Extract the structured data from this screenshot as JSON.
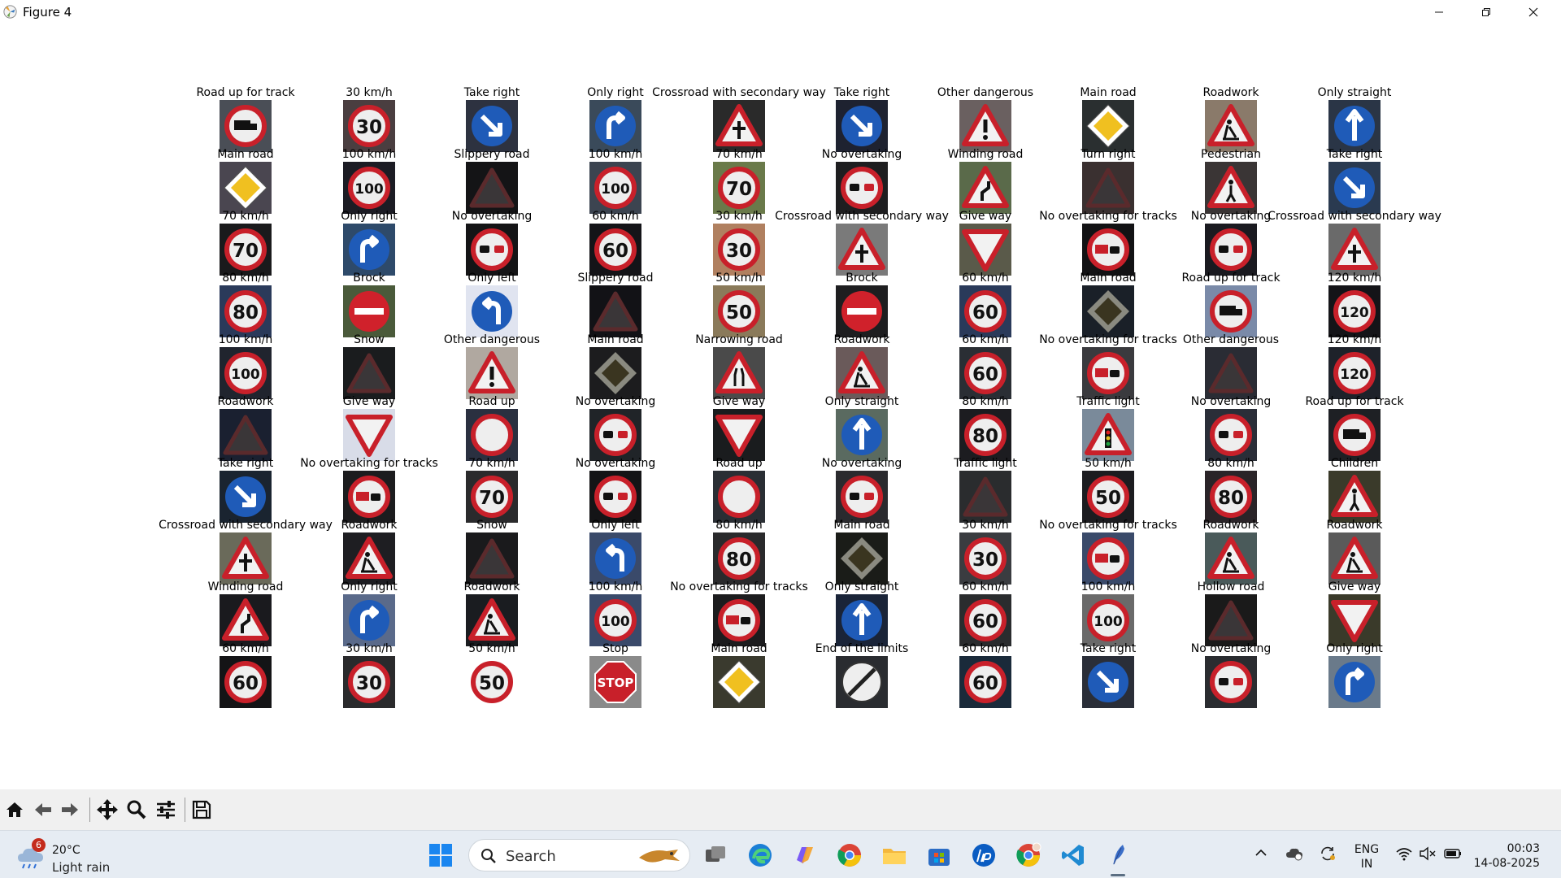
{
  "window": {
    "title": "Figure 4"
  },
  "grid": {
    "rows": [
      [
        {
          "label": "Road up for track",
          "kind": "truck",
          "bg": "#4a4e56"
        },
        {
          "label": "30 km/h",
          "kind": "speed",
          "num": "30",
          "bg": "#4a3e40"
        },
        {
          "label": "Take right",
          "kind": "blue_arrow_dr",
          "bg": "#2d3240"
        },
        {
          "label": "Only right",
          "kind": "blue_arrow_r",
          "bg": "#3a4a5a"
        },
        {
          "label": "Crossroad with secondary way",
          "kind": "tri_cross",
          "bg": "#2a2a2a"
        },
        {
          "label": "Take right",
          "kind": "blue_arrow_dr",
          "bg": "#1e2230"
        },
        {
          "label": "Other dangerous",
          "kind": "tri_excl",
          "bg": "#6a6060"
        },
        {
          "label": "Main road",
          "kind": "diamond",
          "bg": "#2a2f30"
        },
        {
          "label": "Roadwork",
          "kind": "tri_work",
          "bg": "#8a7a6a"
        },
        {
          "label": "Only straight",
          "kind": "blue_arrow_up",
          "bg": "#2a3546"
        }
      ],
      [
        {
          "label": "Main road",
          "kind": "diamond",
          "bg": "#4a4650"
        },
        {
          "label": "100 km/h",
          "kind": "speed",
          "num": "100",
          "bg": "#1c1c24"
        },
        {
          "label": "Slippery road",
          "kind": "tri_dark",
          "bg": "#141416"
        },
        {
          "label": "100 km/h",
          "kind": "speed",
          "num": "100",
          "bg": "#3c4450"
        },
        {
          "label": "70 km/h",
          "kind": "speed",
          "num": "70",
          "bg": "#6a7a4a"
        },
        {
          "label": "No overtaking",
          "kind": "nopass",
          "bg": "#1e1e20"
        },
        {
          "label": "Winding road",
          "kind": "tri_winding",
          "bg": "#5a6a4a"
        },
        {
          "label": "Turn right",
          "kind": "tri_dark",
          "bg": "#3a3030"
        },
        {
          "label": "Pedestrian",
          "kind": "tri_ped",
          "bg": "#3a3535"
        },
        {
          "label": "Take right",
          "kind": "blue_arrow_dr",
          "bg": "#2a3a50"
        }
      ],
      [
        {
          "label": "70 km/h",
          "kind": "speed",
          "num": "70",
          "bg": "#1a1a1c"
        },
        {
          "label": "Only right",
          "kind": "blue_arrow_r",
          "bg": "#2e4a6a"
        },
        {
          "label": "No overtaking",
          "kind": "nopass",
          "bg": "#141416"
        },
        {
          "label": "60 km/h",
          "kind": "speed",
          "num": "60",
          "bg": "#141418"
        },
        {
          "label": "30 km/h",
          "kind": "speed",
          "num": "30",
          "bg": "#b08060"
        },
        {
          "label": "Crossroad with secondary way",
          "kind": "tri_cross",
          "bg": "#7a7a7a"
        },
        {
          "label": "Give way",
          "kind": "giveway",
          "bg": "#5a5a4a"
        },
        {
          "label": "No overtaking for tracks",
          "kind": "notruck",
          "bg": "#121214"
        },
        {
          "label": "No overtaking",
          "kind": "nopass",
          "bg": "#1a1a20"
        },
        {
          "label": "Crossroad with secondary way",
          "kind": "tri_cross",
          "bg": "#6a6a6a"
        }
      ],
      [
        {
          "label": "80 km/h",
          "kind": "speed",
          "num": "80",
          "bg": "#2a3a5a"
        },
        {
          "label": "Brock",
          "kind": "noentry",
          "bg": "#4a5a3a"
        },
        {
          "label": "Only left",
          "kind": "blue_arrow_l",
          "bg": "#e0e4f0"
        },
        {
          "label": "Slippery road",
          "kind": "tri_dark",
          "bg": "#121216"
        },
        {
          "label": "50 km/h",
          "kind": "speed",
          "num": "50",
          "bg": "#8a7a5a"
        },
        {
          "label": "Brock",
          "kind": "noentry",
          "bg": "#1e1e20"
        },
        {
          "label": "60 km/h",
          "kind": "speed",
          "num": "60",
          "bg": "#2a3a5a"
        },
        {
          "label": "Main road",
          "kind": "diamond_dark",
          "bg": "#1a2028"
        },
        {
          "label": "Road up for track",
          "kind": "truck",
          "bg": "#7a8aa8"
        },
        {
          "label": "120 km/h",
          "kind": "speed",
          "num": "120",
          "bg": "#141418"
        }
      ],
      [
        {
          "label": "100 km/h",
          "kind": "speed",
          "num": "100",
          "bg": "#20242e"
        },
        {
          "label": "Snow",
          "kind": "tri_dark",
          "bg": "#1a1c1e"
        },
        {
          "label": "Other dangerous",
          "kind": "tri_excl",
          "bg": "#b0a8a0"
        },
        {
          "label": "Main road",
          "kind": "diamond_dark",
          "bg": "#1c1c1e"
        },
        {
          "label": "Narrowing road",
          "kind": "tri_narrow",
          "bg": "#4a4a4a"
        },
        {
          "label": "Roadwork",
          "kind": "tri_work",
          "bg": "#6a5a5a"
        },
        {
          "label": "60 km/h",
          "kind": "speed",
          "num": "60",
          "bg": "#2a2e34"
        },
        {
          "label": "No overtaking for tracks",
          "kind": "notruck",
          "bg": "#3a3a3e"
        },
        {
          "label": "Other dangerous",
          "kind": "tri_dark",
          "bg": "#2a2c34"
        },
        {
          "label": "120 km/h",
          "kind": "speed",
          "num": "120",
          "bg": "#1e222a"
        }
      ],
      [
        {
          "label": "Roadwork",
          "kind": "tri_dark",
          "bg": "#1a2030"
        },
        {
          "label": "Give way",
          "kind": "giveway",
          "bg": "#d8dce8"
        },
        {
          "label": "Road up",
          "kind": "roadup",
          "bg": "#2a3040"
        },
        {
          "label": "No overtaking",
          "kind": "nopass",
          "bg": "#202428"
        },
        {
          "label": "Give way",
          "kind": "giveway",
          "bg": "#1a1c1e"
        },
        {
          "label": "Only straight",
          "kind": "blue_arrow_up",
          "bg": "#5a6a60"
        },
        {
          "label": "80 km/h",
          "kind": "speed",
          "num": "80",
          "bg": "#1c1c20"
        },
        {
          "label": "Traffic light",
          "kind": "tri_light",
          "bg": "#7a8a9a"
        },
        {
          "label": "No overtaking",
          "kind": "nopass",
          "bg": "#2a2e38"
        },
        {
          "label": "Road up for track",
          "kind": "truck",
          "bg": "#1e2024"
        }
      ],
      [
        {
          "label": "Take right",
          "kind": "blue_arrow_dr",
          "bg": "#1a2430"
        },
        {
          "label": "No overtaking for tracks",
          "kind": "notruck",
          "bg": "#1c1c1e"
        },
        {
          "label": "70 km/h",
          "kind": "speed",
          "num": "70",
          "bg": "#2a2a2c"
        },
        {
          "label": "No overtaking",
          "kind": "nopass",
          "bg": "#141416"
        },
        {
          "label": "Road up",
          "kind": "roadup",
          "bg": "#2a2e34"
        },
        {
          "label": "No overtaking",
          "kind": "nopass",
          "bg": "#2a2a2e"
        },
        {
          "label": "Traffic light",
          "kind": "tri_dark",
          "bg": "#2a2c2e"
        },
        {
          "label": "50 km/h",
          "kind": "speed",
          "num": "50",
          "bg": "#1c1c20"
        },
        {
          "label": "80 km/h",
          "kind": "speed",
          "num": "80",
          "bg": "#2a2428"
        },
        {
          "label": "Children",
          "kind": "tri_ped",
          "bg": "#3a3a2a"
        }
      ],
      [
        {
          "label": "Crossroad with secondary way",
          "kind": "tri_cross",
          "bg": "#6a6a5a"
        },
        {
          "label": "Roadwork",
          "kind": "tri_work",
          "bg": "#1e1e22"
        },
        {
          "label": "Snow",
          "kind": "tri_dark",
          "bg": "#1a1a1c"
        },
        {
          "label": "Only left",
          "kind": "blue_arrow_l",
          "bg": "#3a4a6a"
        },
        {
          "label": "80 km/h",
          "kind": "speed",
          "num": "80",
          "bg": "#2a2a2c"
        },
        {
          "label": "Main road",
          "kind": "diamond_dark",
          "bg": "#1a1c18"
        },
        {
          "label": "30 km/h",
          "kind": "speed",
          "num": "30",
          "bg": "#3a3c40"
        },
        {
          "label": "No overtaking for tracks",
          "kind": "notruck",
          "bg": "#3a4a6a"
        },
        {
          "label": "Roadwork",
          "kind": "tri_work",
          "bg": "#4a5a5a"
        },
        {
          "label": "Roadwork",
          "kind": "tri_work",
          "bg": "#5a5a5a"
        }
      ],
      [
        {
          "label": "Winding road",
          "kind": "tri_winding",
          "bg": "#1a1a1e"
        },
        {
          "label": "Only right",
          "kind": "blue_arrow_r",
          "bg": "#5a6a8a"
        },
        {
          "label": "Roadwork",
          "kind": "tri_work",
          "bg": "#1a1c20"
        },
        {
          "label": "100 km/h",
          "kind": "speed",
          "num": "100",
          "bg": "#3a4a6a"
        },
        {
          "label": "No overtaking for tracks",
          "kind": "notruck",
          "bg": "#1c1c1e"
        },
        {
          "label": "Only straight",
          "kind": "blue_arrow_up",
          "bg": "#1a2438"
        },
        {
          "label": "60 km/h",
          "kind": "speed",
          "num": "60",
          "bg": "#2a2c2e"
        },
        {
          "label": "100 km/h",
          "kind": "speed",
          "num": "100",
          "bg": "#6a6a6a"
        },
        {
          "label": "Hollow road",
          "kind": "tri_dark",
          "bg": "#1a1a1a"
        },
        {
          "label": "Give way",
          "kind": "giveway",
          "bg": "#3a3a2a"
        }
      ],
      [
        {
          "label": "60 km/h",
          "kind": "speed",
          "num": "60",
          "bg": "#141416"
        },
        {
          "label": "30 km/h",
          "kind": "speed",
          "num": "30",
          "bg": "#2a2a2c"
        },
        {
          "label": "50 km/h",
          "kind": "speed",
          "num": "50",
          "bg": "#ffffff"
        },
        {
          "label": "Stop",
          "kind": "stop",
          "bg": "#8a8a8a"
        },
        {
          "label": "Main road",
          "kind": "diamond",
          "bg": "#3a3a2e"
        },
        {
          "label": "End of the limits",
          "kind": "endlimit",
          "bg": "#2a2c30"
        },
        {
          "label": "60 km/h",
          "kind": "speed",
          "num": "60",
          "bg": "#1a2a3a"
        },
        {
          "label": "Take right",
          "kind": "blue_arrow_dr",
          "bg": "#2a2e38"
        },
        {
          "label": "No overtaking",
          "kind": "nopass",
          "bg": "#2a2c30"
        },
        {
          "label": "Only right",
          "kind": "blue_arrow_r",
          "bg": "#6a7a8a"
        }
      ]
    ]
  },
  "toolbar": {
    "buttons": [
      {
        "name": "home-button",
        "icon": "home-icon"
      },
      {
        "name": "back-button",
        "icon": "arrow-left-icon"
      },
      {
        "name": "forward-button",
        "icon": "arrow-right-icon"
      },
      {
        "name": "pan-button",
        "icon": "move-icon"
      },
      {
        "name": "zoom-button",
        "icon": "magnifier-icon"
      },
      {
        "name": "configure-subplots-button",
        "icon": "sliders-icon"
      },
      {
        "name": "save-button",
        "icon": "floppy-icon"
      }
    ]
  },
  "taskbar": {
    "weather": {
      "temp": "20°C",
      "desc": "Light rain",
      "badge": "6"
    },
    "search_placeholder": "Search",
    "lang_line1": "ENG",
    "lang_line2": "IN",
    "time": "00:03",
    "date": "14-08-2025"
  }
}
